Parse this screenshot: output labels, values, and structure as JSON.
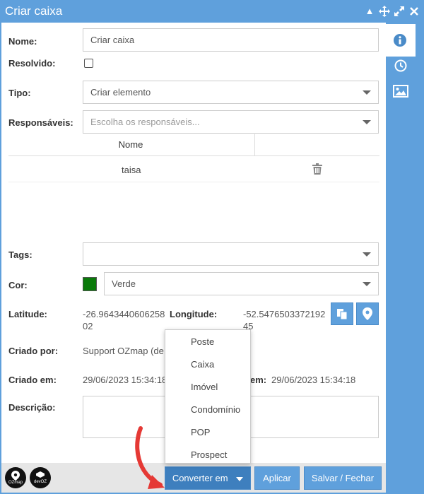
{
  "window": {
    "title": "Criar caixa"
  },
  "form": {
    "nome_label": "Nome:",
    "nome_value": "Criar caixa",
    "resolvido_label": "Resolvido:",
    "tipo_label": "Tipo:",
    "tipo_value": "Criar elemento",
    "responsaveis_label": "Responsáveis:",
    "responsaveis_placeholder": "Escolha os responsáveis...",
    "table_header_nome": "Nome",
    "table_rows": [
      {
        "nome": "taisa"
      }
    ],
    "tags_label": "Tags:",
    "cor_label": "Cor:",
    "cor_value": "Verde",
    "cor_hex": "#0a7a0a",
    "latitude_label": "Latitude:",
    "latitude_line1": "-26.9643440606258",
    "latitude_line2": "02",
    "longitude_label": "Longitude:",
    "longitude_line1": "-52.5476503372192",
    "longitude_line2": "45",
    "criado_por_label": "Criado por:",
    "criado_por_value": "Support OZmap (de",
    "criado_em_label": "Criado em:",
    "criado_em_value": "29/06/2023 15:34:18",
    "atualizado_em_label_partial": "em:",
    "atualizado_em_value": "29/06/2023 15:34:18",
    "descricao_label": "Descrição:"
  },
  "dropdown": {
    "items": [
      "Poste",
      "Caixa",
      "Imóvel",
      "Condomínio",
      "POP",
      "Prospect"
    ]
  },
  "footer": {
    "converter_label": "Converter em",
    "aplicar_label": "Aplicar",
    "salvar_label": "Salvar / Fechar",
    "logo1_text": "OZmap",
    "logo2_text": "devOZ"
  },
  "colors": {
    "accent": "#5fa0dc",
    "arrow": "#e53935"
  }
}
